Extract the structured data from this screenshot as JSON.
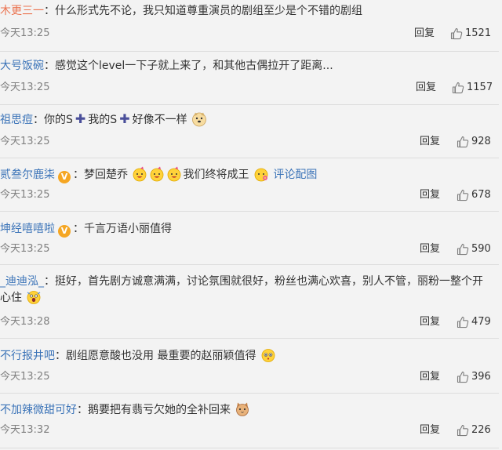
{
  "ui": {
    "reply_label": "回复",
    "colors": {
      "username": "#eb7350",
      "link": "#3c74b8",
      "text": "#333333",
      "time": "#808080",
      "divider": "#dddddd",
      "badge": "#f5a623"
    },
    "icons": [
      "thumbs-up-icon",
      "vip-badge-icon",
      "plus-icon",
      "emoji-icon"
    ]
  },
  "comments": [
    {
      "user": "木更三一",
      "colon": "：",
      "text": "什么形式先不论，我只知道尊重演员的剧组至少是个不错的剧组",
      "time": "今天13:25",
      "likes": "1521"
    },
    {
      "user": "大号饭碗",
      "colon": "：",
      "text": "感觉这个level一下子就上来了，和其他古偶拉开了距离...",
      "time": "今天13:25",
      "likes": "1157"
    },
    {
      "user": "祖思痘",
      "colon": "：",
      "text_a": "你的S",
      "text_b": "我的S",
      "text_c": "好像不一样",
      "time": "今天13:25",
      "likes": "928"
    },
    {
      "user": "贰叁尔鹿柒",
      "colon": "：",
      "text_a": "梦回楚乔",
      "text_b": "我们终将成王",
      "link": "评论配图",
      "time": "今天13:25",
      "likes": "678"
    },
    {
      "user": "坤经嘻嘻啦",
      "colon": "：",
      "text": "千言万语小丽值得",
      "time": "今天13:25",
      "likes": "590"
    },
    {
      "user": "_迪迪泓_",
      "colon": "：",
      "text": "挺好，首先剧方诚意满满，讨论氛围就很好，粉丝也满心欢喜，别人不管，丽粉一整个开心住",
      "time": "今天13:28",
      "likes": "479"
    },
    {
      "user": "不行报井吧",
      "colon": "：",
      "text": "剧组愿意酸也没用 最重要的赵丽颖值得",
      "time": "今天13:25",
      "likes": "396"
    },
    {
      "user": "不加辣微甜可好",
      "colon": "：",
      "text": "鹅要把有翡亏欠她的全补回来",
      "time": "今天13:32",
      "likes": "226"
    }
  ]
}
